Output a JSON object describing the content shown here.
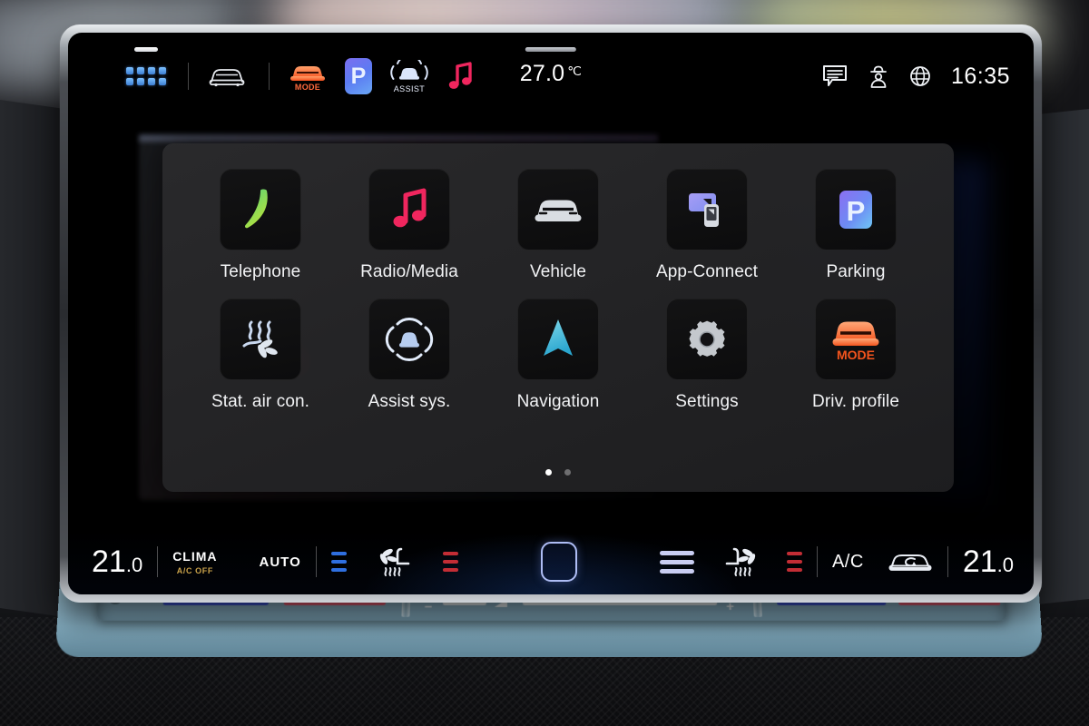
{
  "status_bar": {
    "app_grid_icon": "app-grid-icon",
    "icons": [
      {
        "name": "vehicle-outline-icon",
        "label": ""
      },
      {
        "name": "driving-mode-icon",
        "label": "MODE"
      },
      {
        "name": "parking-icon",
        "label": "P"
      },
      {
        "name": "assist-icon",
        "label": "ASSIST"
      },
      {
        "name": "media-note-icon",
        "label": ""
      }
    ],
    "outside_temperature": "27.0",
    "temperature_unit": "℃",
    "right_icons": [
      {
        "name": "message-icon"
      },
      {
        "name": "privacy-person-icon"
      },
      {
        "name": "globe-icon"
      }
    ],
    "time": "16:35"
  },
  "app_drawer": {
    "apps": [
      {
        "label": "Telephone",
        "icon": "phone-icon",
        "color": "#8ed24a"
      },
      {
        "label": "Radio/Media",
        "icon": "music-note-icon",
        "color": "#f0265e"
      },
      {
        "label": "Vehicle",
        "icon": "car-front-icon",
        "color": "#d9dde2"
      },
      {
        "label": "App-Connect",
        "icon": "app-connect-icon",
        "color": "#9a8cf0"
      },
      {
        "label": "Parking",
        "icon": "parking-p-icon",
        "color": "#6f7ef3"
      },
      {
        "label": "Stat. air con.",
        "icon": "stationary-air-con-icon",
        "color": "#c9d8ef"
      },
      {
        "label": "Assist sys.",
        "icon": "assist-systems-icon",
        "color": "#b7cdf0"
      },
      {
        "label": "Navigation",
        "icon": "navigation-arrow-icon",
        "color": "#4ec3e0"
      },
      {
        "label": "Settings",
        "icon": "gear-icon",
        "color": "#c4c8cd"
      },
      {
        "label": "Driv. profile",
        "icon": "driving-profile-icon",
        "color": "#f3703c"
      }
    ],
    "page_dots": {
      "count": 2,
      "active_index": 0
    }
  },
  "climate_bar": {
    "left_temperature": "21",
    "left_temperature_decimal": ".0",
    "clima_label": "CLIMA",
    "ac_status_label": "A/C OFF",
    "auto_label": "AUTO",
    "left_seat_icon": "seat-climate-left-icon",
    "center_button_icon": "climate-menu-button",
    "fan_bars_icon": "fan-speed-bars",
    "right_seat_icon": "seat-climate-right-icon",
    "ac_label": "A/C",
    "recirculation_icon": "air-recirculation-icon",
    "right_temperature": "21",
    "right_temperature_decimal": ".0",
    "cool_bars_color": "#2f6fe0",
    "heat_bars_color": "#c32d35",
    "fan_bars_color": "#c9cdf2"
  },
  "hardware_panel": {
    "power_button": "power-button",
    "left_temp_slider": "left-temperature-slider",
    "volume_slider": "volume-slider",
    "volume_minus": "–",
    "volume_plus": "+",
    "right_temp_slider": "right-temperature-slider"
  }
}
